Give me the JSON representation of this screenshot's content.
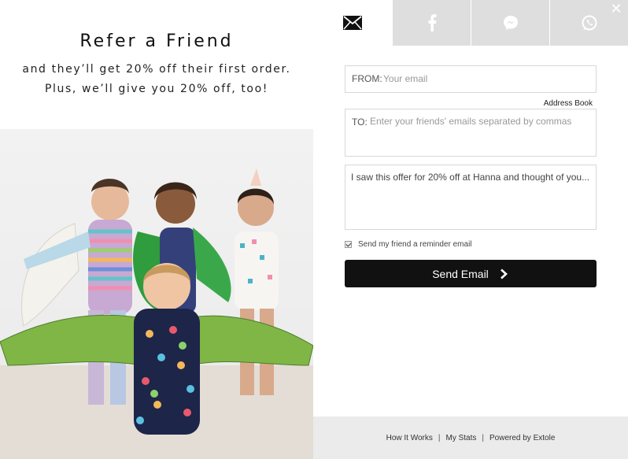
{
  "promo": {
    "title": "Refer a Friend",
    "line1": "and they’ll get 20% off their first order.",
    "line2": "Plus, we’ll give you 20% off, too!"
  },
  "tabs": [
    {
      "name": "email",
      "icon": "envelope-icon",
      "active": true
    },
    {
      "name": "facebook",
      "icon": "facebook-icon",
      "active": false
    },
    {
      "name": "messenger",
      "icon": "messenger-icon",
      "active": false
    },
    {
      "name": "whatsapp",
      "icon": "whatsapp-icon",
      "active": false
    }
  ],
  "close_icon": "close-icon",
  "form": {
    "from_label": "FROM:",
    "from_placeholder": "Your email",
    "address_book": "Address Book",
    "to_label": "TO:",
    "to_placeholder": "Enter your friends' emails separated by commas",
    "message": "I saw this offer for 20% off at Hanna and thought of you...",
    "reminder_label": "Send my friend a reminder email",
    "reminder_checked": true,
    "send_label": "Send Email"
  },
  "footer": {
    "how_it_works": "How It Works",
    "my_stats": "My Stats",
    "powered_by": "Powered by Extole",
    "separator": "|"
  },
  "colors": {
    "send_button": "#111111",
    "tab_inactive": "#dedede",
    "footer_bg": "#ebebeb"
  }
}
